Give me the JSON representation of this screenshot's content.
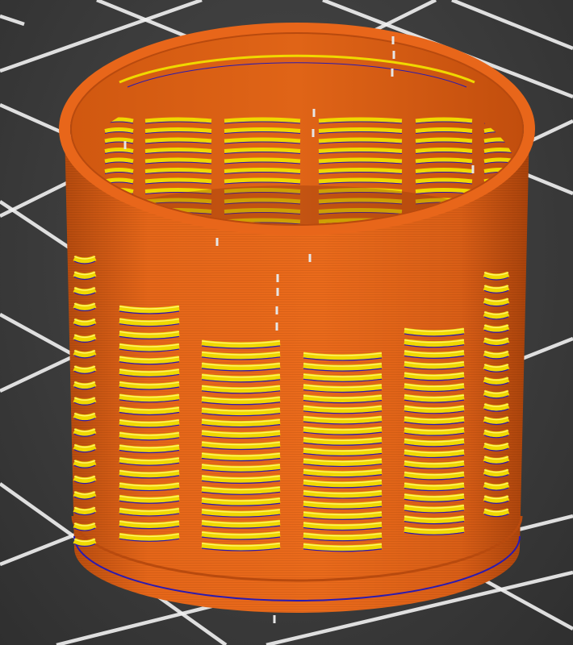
{
  "viewport": {
    "name": "3d-preview",
    "background_color": "#3c3c3c",
    "bed_grid_color": "#f2f2f2"
  },
  "model": {
    "name": "slotted-cylinder",
    "colors": {
      "outer_wall": "#e8661a",
      "outer_wall_dark": "#b84a0e",
      "outer_wall_shadow": "#8f3608",
      "inner_wall": "#c9540f",
      "infill": "#f0d800",
      "infill_light": "#fff36a",
      "travel_line": "#2a1ab0",
      "seam_marker": "#e6e6e6"
    },
    "slot_columns": 6,
    "slot_rows": 19
  }
}
